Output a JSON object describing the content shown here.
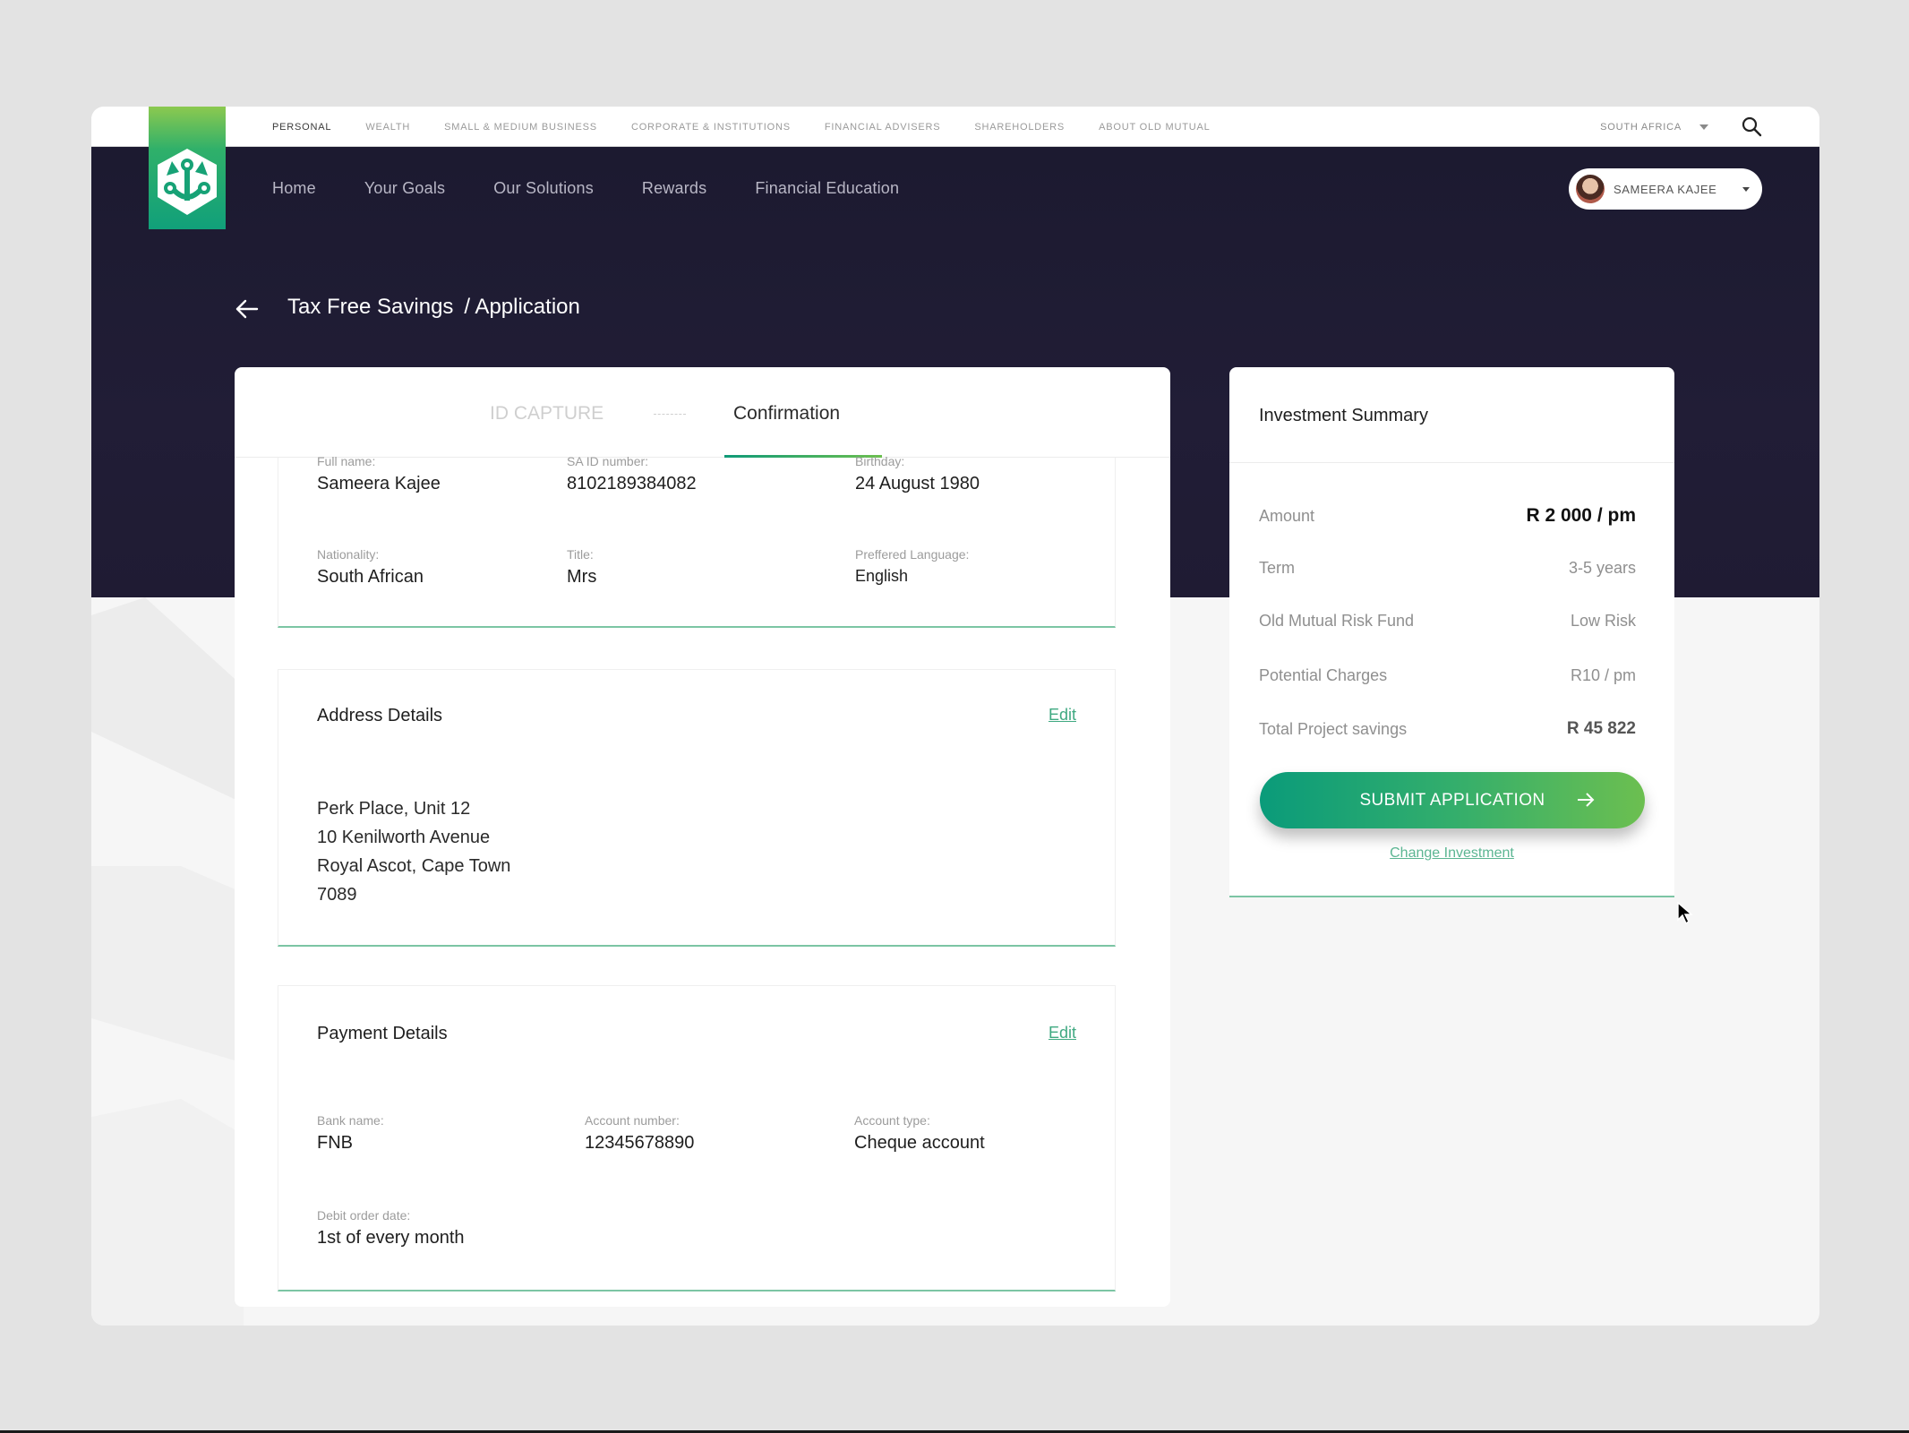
{
  "top_nav": {
    "items": [
      "PERSONAL",
      "WEALTH",
      "SMALL & MEDIUM BUSINESS",
      "CORPORATE & INSTITUTIONS",
      "FINANCIAL ADVISERS",
      "SHAREHOLDERS",
      "ABOUT OLD MUTUAL"
    ],
    "active": "PERSONAL",
    "region": "SOUTH AFRICA",
    "search_icon": "search-icon"
  },
  "brand": {
    "logo_icon": "old-mutual-anchor-logo",
    "colors": {
      "green_dark": "#11a07a",
      "green_light": "#8cc94f",
      "navy": "#1f1b33",
      "accent_line": "#7cc5a4"
    }
  },
  "main_nav": {
    "items": [
      "Home",
      "Your Goals",
      "Our Solutions",
      "Rewards",
      "Financial Education"
    ]
  },
  "user": {
    "name": "SAMEERA KAJEE"
  },
  "breadcrumb": {
    "back_icon": "arrow-left-icon",
    "section": "Tax Free Savings",
    "page": "/ Application"
  },
  "steps": {
    "step1": "ID CAPTURE",
    "step2": "Confirmation",
    "active": "Confirmation"
  },
  "personal": {
    "fields": [
      {
        "label": "Full name:",
        "value": "Sameera Kajee"
      },
      {
        "label": "SA ID number:",
        "value": "8102189384082"
      },
      {
        "label": "Birthday:",
        "value": "24 August 1980"
      },
      {
        "label": "Nationality:",
        "value": "South African"
      },
      {
        "label": "Title:",
        "value": "Mrs"
      },
      {
        "label": "Preffered Language:",
        "value": "English"
      }
    ]
  },
  "address": {
    "title": "Address Details",
    "edit": "Edit",
    "lines": [
      "Perk Place, Unit 12",
      "10 Kenilworth Avenue",
      "Royal Ascot, Cape Town",
      "7089"
    ]
  },
  "payment": {
    "title": "Payment Details",
    "edit": "Edit",
    "fields": [
      {
        "label": "Bank name:",
        "value": "FNB"
      },
      {
        "label": "Account number:",
        "value": "12345678890"
      },
      {
        "label": "Account type:",
        "value": "Cheque account"
      },
      {
        "label": "Debit order date:",
        "value": "1st of every month"
      }
    ]
  },
  "summary": {
    "title": "Investment Summary",
    "rows": [
      {
        "key": "Amount",
        "value": "R 2 000 / pm"
      },
      {
        "key": "Term",
        "value": "3-5 years"
      },
      {
        "key": "Old Mutual Risk Fund",
        "value": "Low Risk"
      },
      {
        "key": "Potential Charges",
        "value": "R10 / pm"
      },
      {
        "key": "Total Project savings",
        "value": "R 45 822"
      }
    ],
    "submit": "SUBMIT APPLICATION",
    "change": "Change Investment"
  }
}
